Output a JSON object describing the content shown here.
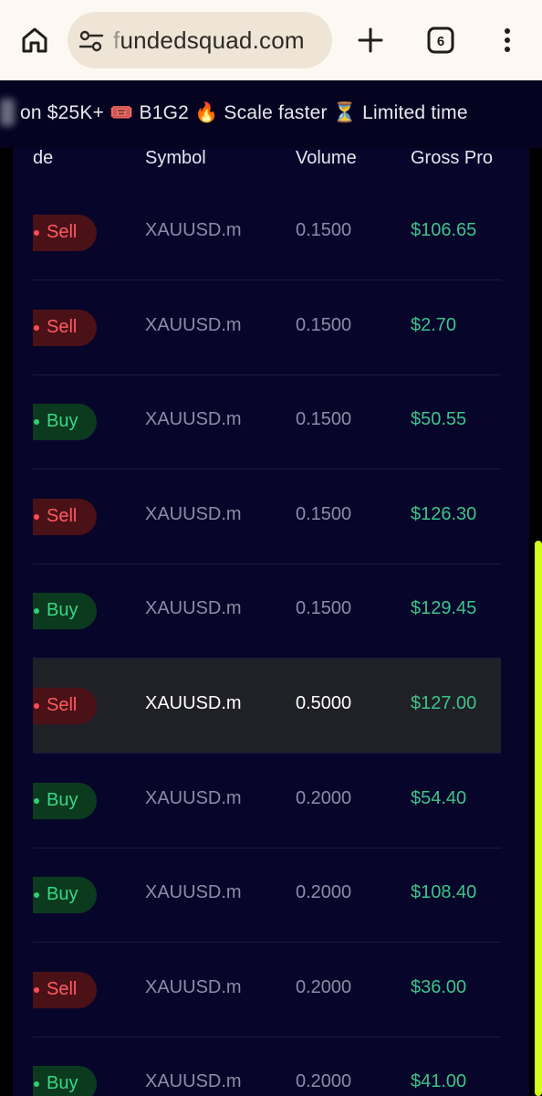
{
  "browser": {
    "url_faded_prefix": "f",
    "url_rest": "undedsquad.com",
    "tab_count": "6"
  },
  "ticker": {
    "text": "on $25K+ 🎟️ B1G2 🔥 Scale faster ⏳ Limited time"
  },
  "table": {
    "headers": {
      "side": "de",
      "symbol": "Symbol",
      "volume": "Volume",
      "gross_profit": "Gross Pro"
    },
    "rows": [
      {
        "side": "Sell",
        "symbol": "XAUUSD.m",
        "volume": "0.1500",
        "profit": "$106.65"
      },
      {
        "side": "Sell",
        "symbol": "XAUUSD.m",
        "volume": "0.1500",
        "profit": "$2.70"
      },
      {
        "side": "Buy",
        "symbol": "XAUUSD.m",
        "volume": "0.1500",
        "profit": "$50.55"
      },
      {
        "side": "Sell",
        "symbol": "XAUUSD.m",
        "volume": "0.1500",
        "profit": "$126.30"
      },
      {
        "side": "Buy",
        "symbol": "XAUUSD.m",
        "volume": "0.1500",
        "profit": "$129.45"
      },
      {
        "side": "Sell",
        "symbol": "XAUUSD.m",
        "volume": "0.5000",
        "profit": "$127.00"
      },
      {
        "side": "Buy",
        "symbol": "XAUUSD.m",
        "volume": "0.2000",
        "profit": "$54.40"
      },
      {
        "side": "Buy",
        "symbol": "XAUUSD.m",
        "volume": "0.2000",
        "profit": "$108.40"
      },
      {
        "side": "Sell",
        "symbol": "XAUUSD.m",
        "volume": "0.2000",
        "profit": "$36.00"
      },
      {
        "side": "Buy",
        "symbol": "XAUUSD.m",
        "volume": "0.2000",
        "profit": "$41.00"
      }
    ]
  },
  "colors": {
    "sell_text": "#ff5a64",
    "buy_text": "#36d884",
    "profit_text": "#3cc48a",
    "table_bg": "#07052a",
    "scrollbar": "#d4ff1a"
  }
}
